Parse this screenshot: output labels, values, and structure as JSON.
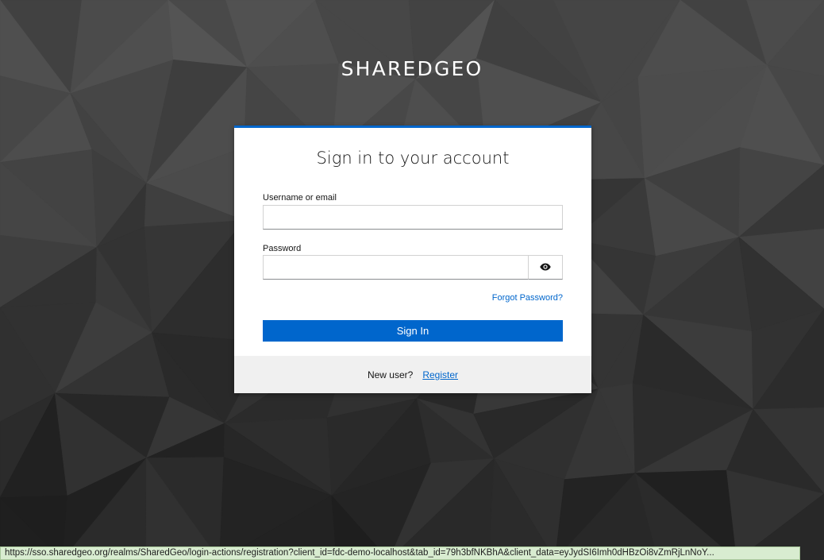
{
  "brand": {
    "title": "SHAREDGEO"
  },
  "login": {
    "heading": "Sign in to your account",
    "username_label": "Username or email",
    "username_value": "",
    "password_label": "Password",
    "password_value": "",
    "show_password_icon": "eye-icon",
    "forgot_label": "Forgot Password?",
    "submit_label": "Sign In"
  },
  "register": {
    "prompt": "New user?",
    "link_label": "Register"
  },
  "status_bar": {
    "url": "https://sso.sharedgeo.org/realms/SharedGeo/login-actions/registration?client_id=fdc-demo-localhost&tab_id=79h3bfNKBhA&client_data=eyJydSI6Imh0dHBzOi8vZmRjLnNoY..."
  },
  "colors": {
    "accent": "#0066cc",
    "background": "#2b2b2b",
    "card": "#ffffff",
    "footer": "#f0f0f0",
    "status_bar": "#d8ecd0"
  }
}
